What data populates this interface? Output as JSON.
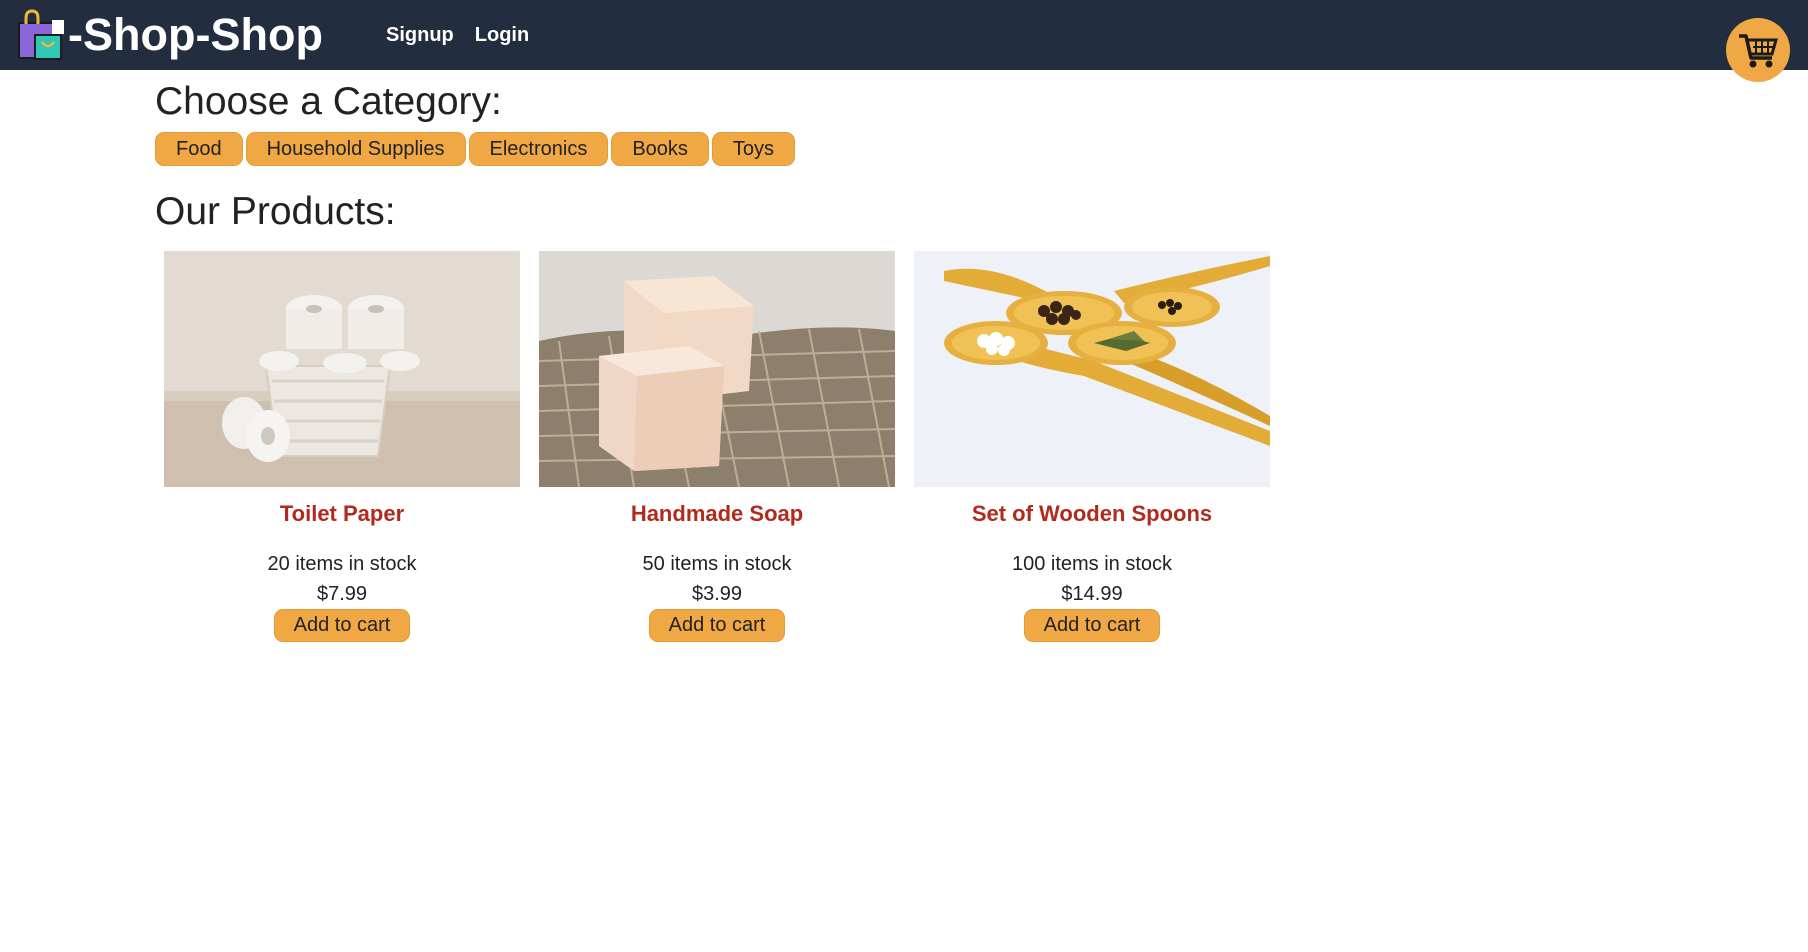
{
  "header": {
    "brand_title": "-Shop-Shop",
    "brand_icon": "shopping-bag-icon",
    "nav": [
      {
        "label": "Signup"
      },
      {
        "label": "Login"
      }
    ],
    "cart_icon": "shopping-cart-icon"
  },
  "categories": {
    "heading": "Choose a Category:",
    "items": [
      {
        "label": "Food"
      },
      {
        "label": "Household Supplies"
      },
      {
        "label": "Electronics"
      },
      {
        "label": "Books"
      },
      {
        "label": "Toys"
      }
    ]
  },
  "products": {
    "heading": "Our Products:",
    "items": [
      {
        "name": "Toilet Paper",
        "stock": "20 items in stock",
        "price": "$7.99",
        "button": "Add to cart"
      },
      {
        "name": "Handmade Soap",
        "stock": "50 items in stock",
        "price": "$3.99",
        "button": "Add to cart"
      },
      {
        "name": "Set of Wooden Spoons",
        "stock": "100 items in stock",
        "price": "$14.99",
        "button": "Add to cart"
      }
    ]
  },
  "colors": {
    "header_bg": "#222d3f",
    "accent": "#f0a845",
    "product_name": "#b22a1c"
  }
}
